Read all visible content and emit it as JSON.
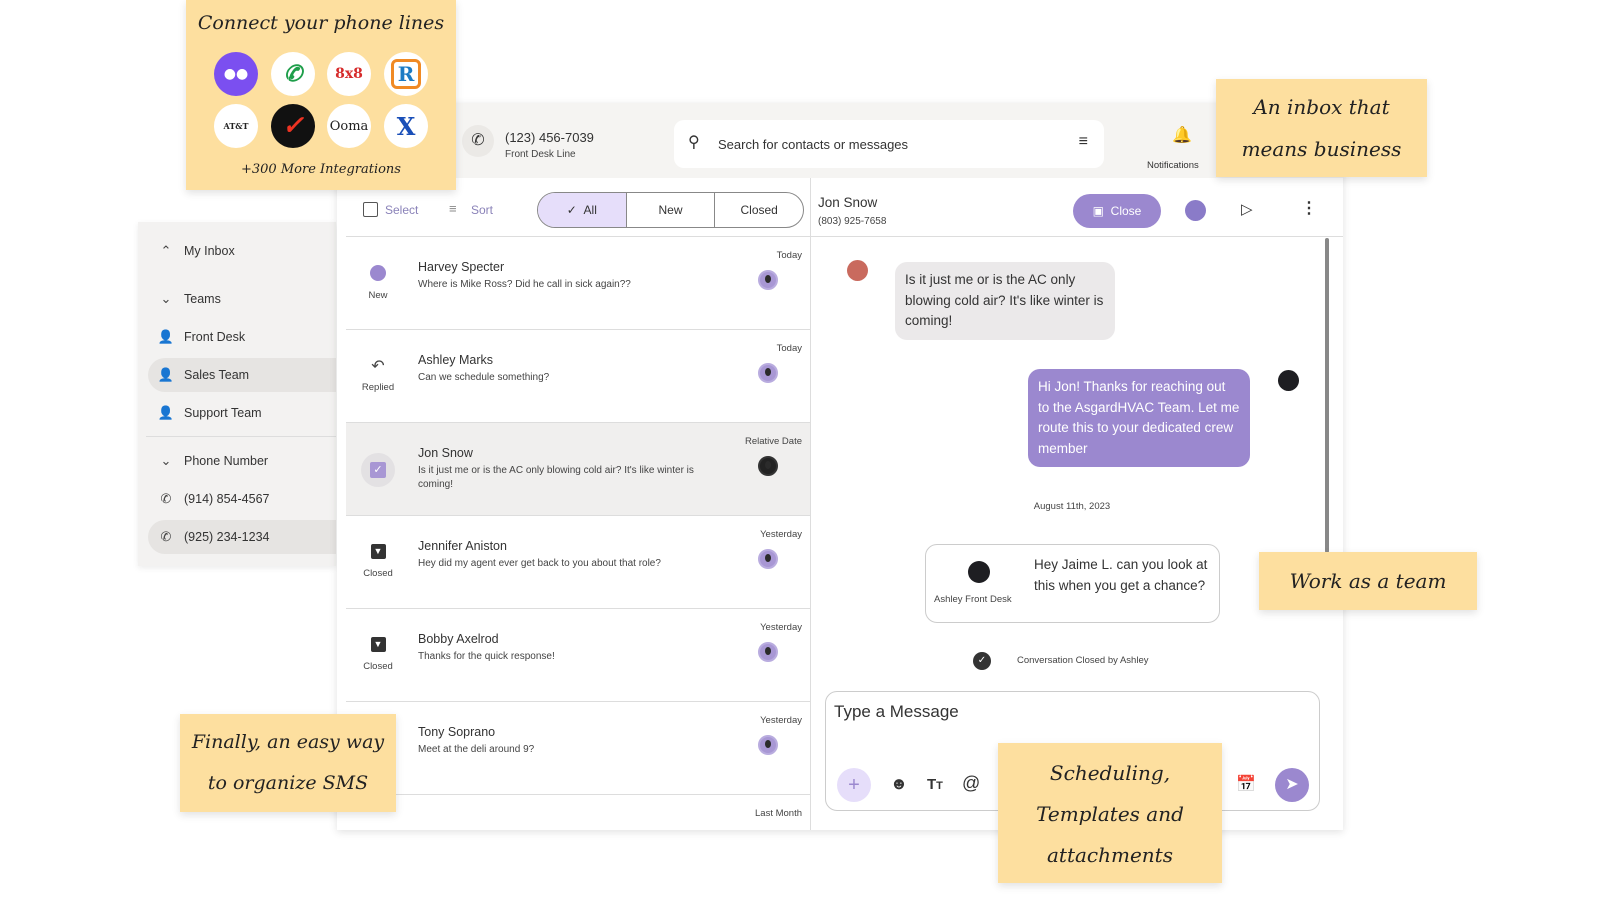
{
  "stickies": {
    "phone_lines": "Connect your phone lines",
    "integrations": "+300 More Integrations",
    "inbox_line1": "An inbox that",
    "inbox_line2": "means business",
    "team": "Work as a team",
    "organize_line1": "Finally, an easy way",
    "organize_line2": "to organize SMS",
    "sched_line1": "Scheduling,",
    "sched_line2": "Templates and",
    "sched_line3": "attachments"
  },
  "integration_logos": [
    "dialpad",
    "google-voice",
    "8x8",
    "ringcentral",
    "AT&T",
    "verizon",
    "Ooma",
    "nextiva"
  ],
  "logo_text": {
    "eight": "8x8",
    "att": "AT&T",
    "ooma": "Ooma"
  },
  "header": {
    "phone_number": "(123) 456-7039",
    "line_name": "Front Desk Line",
    "search_placeholder": "Search for contacts or messages",
    "notifications": "Notifications"
  },
  "sidebar": {
    "items": [
      {
        "label": "My Inbox",
        "icon": "chevron-up"
      },
      {
        "label": "Teams",
        "icon": "chevron-down"
      },
      {
        "label": "Front Desk",
        "icon": "person"
      },
      {
        "label": "Sales Team",
        "icon": "person",
        "selected": true
      },
      {
        "label": "Support Team",
        "icon": "person"
      },
      {
        "label": "Phone Number",
        "icon": "chevron-down"
      },
      {
        "label": "(914) 854-4567",
        "icon": "phone"
      },
      {
        "label": "(925) 234-1234",
        "icon": "phone",
        "selected": true
      }
    ]
  },
  "list_toolbar": {
    "select": "Select",
    "sort": "Sort",
    "filters": [
      "All",
      "New",
      "Closed"
    ],
    "active_filter": "All"
  },
  "conversations": [
    {
      "name": "Harvey Specter",
      "message": "Where is Mike Ross? Did he call in sick again??",
      "date": "Today",
      "status": "New"
    },
    {
      "name": "Ashley Marks",
      "message": "Can we schedule something?",
      "date": "Today",
      "status": "Replied"
    },
    {
      "name": "Jon Snow",
      "message": "Is it just me or is the AC only blowing cold air? It's like winter is coming!",
      "date": "Relative Date",
      "status": "",
      "selected": true
    },
    {
      "name": "Jennifer Aniston",
      "message": "Hey did my agent ever get back to you about that role?",
      "date": "Yesterday",
      "status": "Closed"
    },
    {
      "name": "Bobby Axelrod",
      "message": "Thanks for the quick response!",
      "date": "Yesterday",
      "status": "Closed"
    },
    {
      "name": "Tony Soprano",
      "message": "Meet at the deli around 9?",
      "date": "Yesterday",
      "status": ""
    },
    {
      "name": "",
      "message": "",
      "date": "Last Month",
      "status": ""
    }
  ],
  "chat": {
    "contact_name": "Jon Snow",
    "contact_phone": "(803) 925-7658",
    "close_label": "Close",
    "incoming": "Is it just me or is the AC only blowing cold air? It's like winter is coming!",
    "outgoing": "Hi Jon! Thanks for reaching out to the AsgardHVAC Team. Let me route this to your dedicated crew member",
    "date_divider": "August 11th, 2023",
    "note_author": "Ashley Front Desk",
    "note_text": "Hey Jaime L. can you look at this when you get a chance?",
    "closed_event": "Conversation Closed by Ashley",
    "composer_placeholder": "Type a Message"
  },
  "colors": {
    "accent": "#9b88cf",
    "accent_light": "#e6defa",
    "sticky": "#fddf9f",
    "panel": "#f5f4f2"
  }
}
